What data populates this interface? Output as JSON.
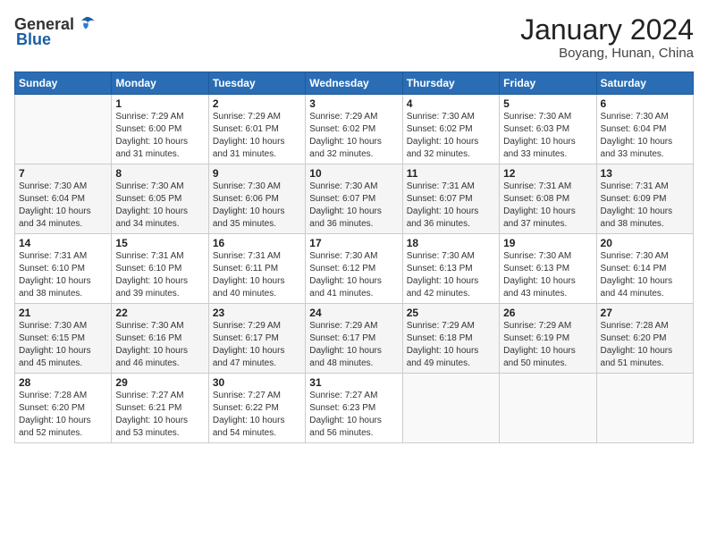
{
  "header": {
    "logo": {
      "general": "General",
      "blue": "Blue"
    },
    "title": "January 2024",
    "subtitle": "Boyang, Hunan, China"
  },
  "calendar": {
    "weekdays": [
      "Sunday",
      "Monday",
      "Tuesday",
      "Wednesday",
      "Thursday",
      "Friday",
      "Saturday"
    ],
    "weeks": [
      [
        {
          "day": "",
          "info": ""
        },
        {
          "day": "1",
          "info": "Sunrise: 7:29 AM\nSunset: 6:00 PM\nDaylight: 10 hours\nand 31 minutes."
        },
        {
          "day": "2",
          "info": "Sunrise: 7:29 AM\nSunset: 6:01 PM\nDaylight: 10 hours\nand 31 minutes."
        },
        {
          "day": "3",
          "info": "Sunrise: 7:29 AM\nSunset: 6:02 PM\nDaylight: 10 hours\nand 32 minutes."
        },
        {
          "day": "4",
          "info": "Sunrise: 7:30 AM\nSunset: 6:02 PM\nDaylight: 10 hours\nand 32 minutes."
        },
        {
          "day": "5",
          "info": "Sunrise: 7:30 AM\nSunset: 6:03 PM\nDaylight: 10 hours\nand 33 minutes."
        },
        {
          "day": "6",
          "info": "Sunrise: 7:30 AM\nSunset: 6:04 PM\nDaylight: 10 hours\nand 33 minutes."
        }
      ],
      [
        {
          "day": "7",
          "info": "Sunrise: 7:30 AM\nSunset: 6:04 PM\nDaylight: 10 hours\nand 34 minutes."
        },
        {
          "day": "8",
          "info": "Sunrise: 7:30 AM\nSunset: 6:05 PM\nDaylight: 10 hours\nand 34 minutes."
        },
        {
          "day": "9",
          "info": "Sunrise: 7:30 AM\nSunset: 6:06 PM\nDaylight: 10 hours\nand 35 minutes."
        },
        {
          "day": "10",
          "info": "Sunrise: 7:30 AM\nSunset: 6:07 PM\nDaylight: 10 hours\nand 36 minutes."
        },
        {
          "day": "11",
          "info": "Sunrise: 7:31 AM\nSunset: 6:07 PM\nDaylight: 10 hours\nand 36 minutes."
        },
        {
          "day": "12",
          "info": "Sunrise: 7:31 AM\nSunset: 6:08 PM\nDaylight: 10 hours\nand 37 minutes."
        },
        {
          "day": "13",
          "info": "Sunrise: 7:31 AM\nSunset: 6:09 PM\nDaylight: 10 hours\nand 38 minutes."
        }
      ],
      [
        {
          "day": "14",
          "info": "Sunrise: 7:31 AM\nSunset: 6:10 PM\nDaylight: 10 hours\nand 38 minutes."
        },
        {
          "day": "15",
          "info": "Sunrise: 7:31 AM\nSunset: 6:10 PM\nDaylight: 10 hours\nand 39 minutes."
        },
        {
          "day": "16",
          "info": "Sunrise: 7:31 AM\nSunset: 6:11 PM\nDaylight: 10 hours\nand 40 minutes."
        },
        {
          "day": "17",
          "info": "Sunrise: 7:30 AM\nSunset: 6:12 PM\nDaylight: 10 hours\nand 41 minutes."
        },
        {
          "day": "18",
          "info": "Sunrise: 7:30 AM\nSunset: 6:13 PM\nDaylight: 10 hours\nand 42 minutes."
        },
        {
          "day": "19",
          "info": "Sunrise: 7:30 AM\nSunset: 6:13 PM\nDaylight: 10 hours\nand 43 minutes."
        },
        {
          "day": "20",
          "info": "Sunrise: 7:30 AM\nSunset: 6:14 PM\nDaylight: 10 hours\nand 44 minutes."
        }
      ],
      [
        {
          "day": "21",
          "info": "Sunrise: 7:30 AM\nSunset: 6:15 PM\nDaylight: 10 hours\nand 45 minutes."
        },
        {
          "day": "22",
          "info": "Sunrise: 7:30 AM\nSunset: 6:16 PM\nDaylight: 10 hours\nand 46 minutes."
        },
        {
          "day": "23",
          "info": "Sunrise: 7:29 AM\nSunset: 6:17 PM\nDaylight: 10 hours\nand 47 minutes."
        },
        {
          "day": "24",
          "info": "Sunrise: 7:29 AM\nSunset: 6:17 PM\nDaylight: 10 hours\nand 48 minutes."
        },
        {
          "day": "25",
          "info": "Sunrise: 7:29 AM\nSunset: 6:18 PM\nDaylight: 10 hours\nand 49 minutes."
        },
        {
          "day": "26",
          "info": "Sunrise: 7:29 AM\nSunset: 6:19 PM\nDaylight: 10 hours\nand 50 minutes."
        },
        {
          "day": "27",
          "info": "Sunrise: 7:28 AM\nSunset: 6:20 PM\nDaylight: 10 hours\nand 51 minutes."
        }
      ],
      [
        {
          "day": "28",
          "info": "Sunrise: 7:28 AM\nSunset: 6:20 PM\nDaylight: 10 hours\nand 52 minutes."
        },
        {
          "day": "29",
          "info": "Sunrise: 7:27 AM\nSunset: 6:21 PM\nDaylight: 10 hours\nand 53 minutes."
        },
        {
          "day": "30",
          "info": "Sunrise: 7:27 AM\nSunset: 6:22 PM\nDaylight: 10 hours\nand 54 minutes."
        },
        {
          "day": "31",
          "info": "Sunrise: 7:27 AM\nSunset: 6:23 PM\nDaylight: 10 hours\nand 56 minutes."
        },
        {
          "day": "",
          "info": ""
        },
        {
          "day": "",
          "info": ""
        },
        {
          "day": "",
          "info": ""
        }
      ]
    ]
  }
}
